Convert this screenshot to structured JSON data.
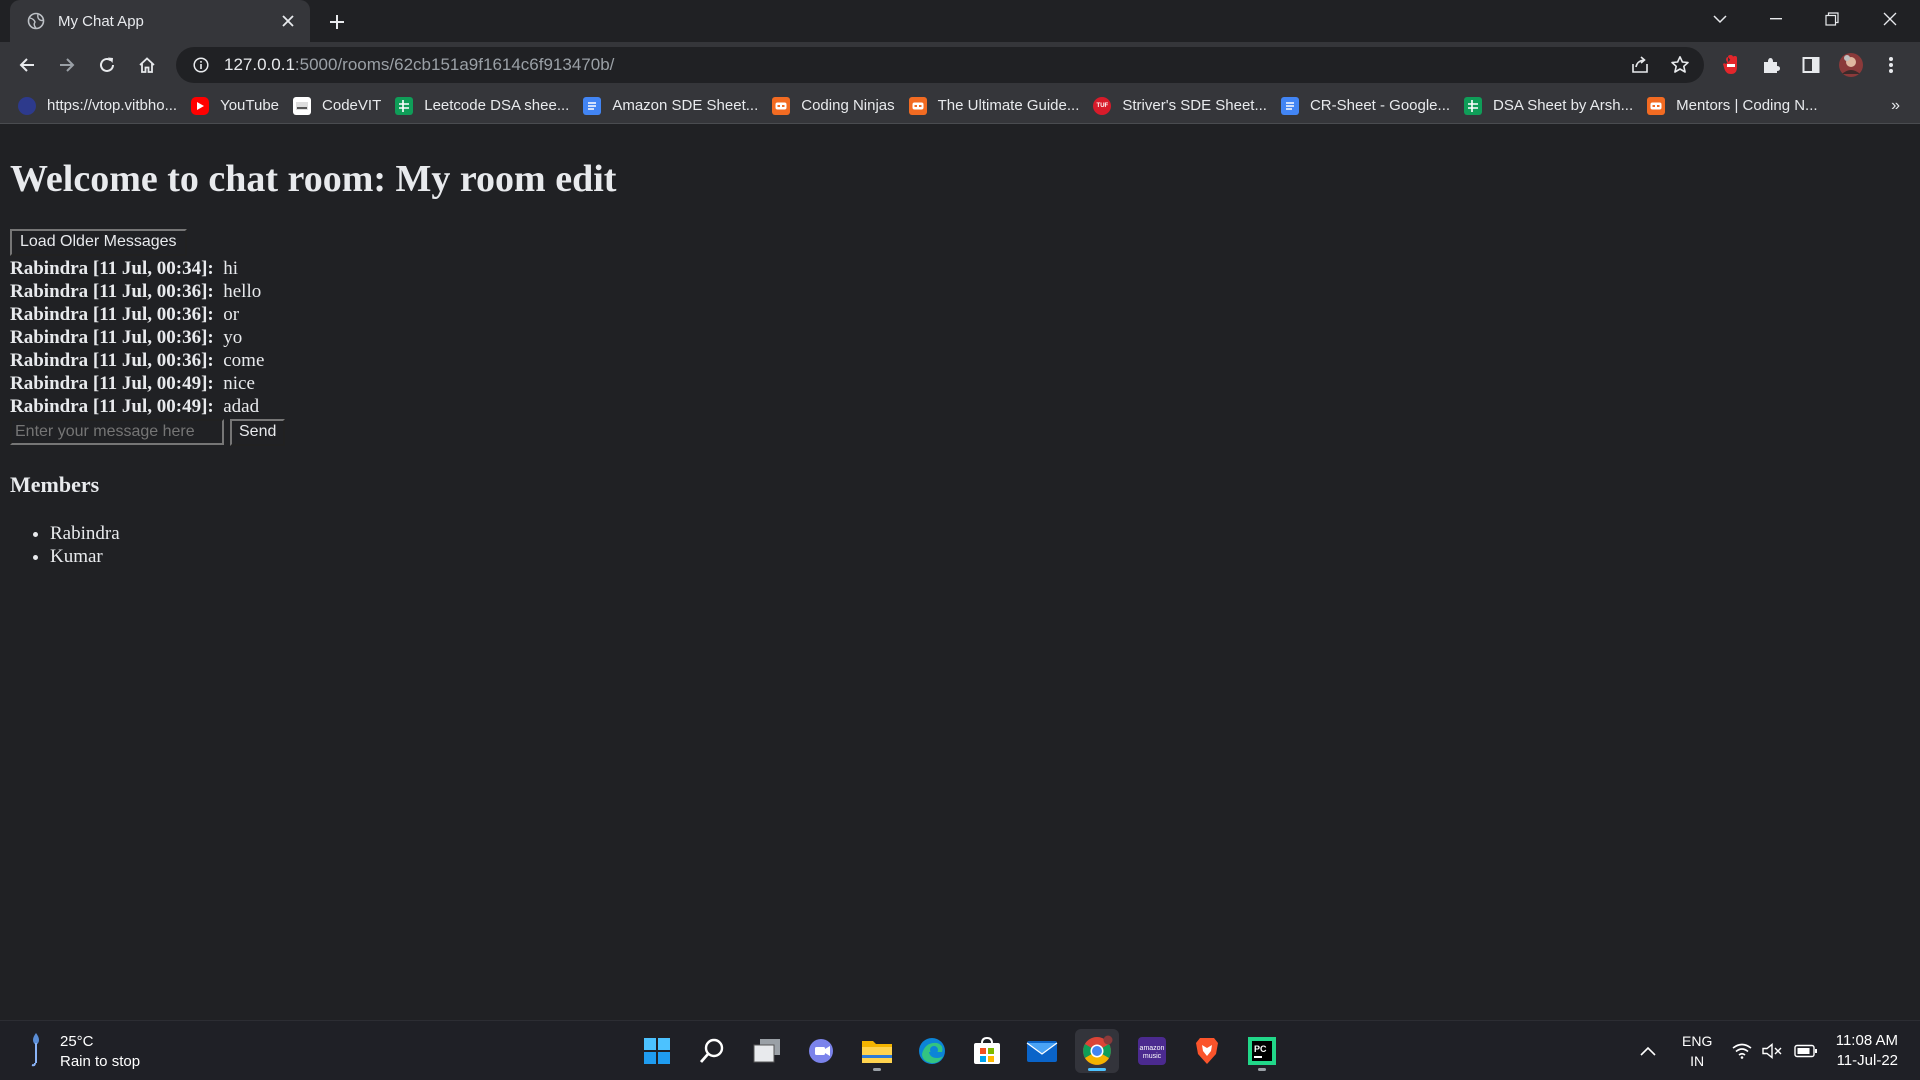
{
  "browser": {
    "tab_title": "My Chat App",
    "url_host": "127.0.0.1",
    "url_rest": ":5000/rooms/62cb151a9f1614c6f913470b/",
    "bookmarks": [
      {
        "label": "https://vtop.vitbho...",
        "icon": "vtop-icon",
        "color": "#2d3a8c"
      },
      {
        "label": "YouTube",
        "icon": "youtube-icon",
        "color": "#ff0000"
      },
      {
        "label": "CodeVIT",
        "icon": "codevit-icon",
        "color": "#ffffff"
      },
      {
        "label": "Leetcode DSA shee...",
        "icon": "sheets-icon",
        "color": "#0f9d58"
      },
      {
        "label": "Amazon SDE Sheet...",
        "icon": "docs-icon",
        "color": "#4285f4"
      },
      {
        "label": "Coding Ninjas",
        "icon": "coding-ninjas-icon",
        "color": "#f26b22"
      },
      {
        "label": "The Ultimate Guide...",
        "icon": "coding-ninjas-icon",
        "color": "#f26b22"
      },
      {
        "label": "Striver's SDE Sheet...",
        "icon": "tuf-icon",
        "color": "#d81b2a"
      },
      {
        "label": "CR-Sheet - Google...",
        "icon": "docs-icon",
        "color": "#4285f4"
      },
      {
        "label": "DSA Sheet by Arsh...",
        "icon": "sheets-icon",
        "color": "#0f9d58"
      },
      {
        "label": "Mentors | Coding N...",
        "icon": "coding-ninjas-icon",
        "color": "#f26b22"
      }
    ],
    "more_bookmarks": "»"
  },
  "page": {
    "title": "Welcome to chat room: My room edit",
    "load_older_label": "Load Older Messages",
    "messages": [
      {
        "sender": "Rabindra [11 Jul, 00:34]:",
        "text": "hi"
      },
      {
        "sender": "Rabindra [11 Jul, 00:36]:",
        "text": "hello"
      },
      {
        "sender": "Rabindra [11 Jul, 00:36]:",
        "text": "or"
      },
      {
        "sender": "Rabindra [11 Jul, 00:36]:",
        "text": "yo"
      },
      {
        "sender": "Rabindra [11 Jul, 00:36]:",
        "text": "come"
      },
      {
        "sender": "Rabindra [11 Jul, 00:49]:",
        "text": "nice"
      },
      {
        "sender": "Rabindra [11 Jul, 00:49]:",
        "text": "adad"
      }
    ],
    "message_placeholder": "Enter your message here",
    "send_label": "Send",
    "members_heading": "Members",
    "members": [
      "Rabindra",
      "Kumar"
    ]
  },
  "taskbar": {
    "weather_temp": "25°C",
    "weather_desc": "Rain to stop",
    "lang_top": "ENG",
    "lang_bottom": "IN",
    "time": "11:08 AM",
    "date": "11-Jul-22",
    "apps": [
      "start-icon",
      "search-icon",
      "task-view-icon",
      "teams-chat-icon",
      "file-explorer-icon",
      "edge-icon",
      "store-icon",
      "mail-icon",
      "chrome-icon",
      "amazon-music-icon",
      "brave-icon",
      "pycharm-icon"
    ]
  }
}
